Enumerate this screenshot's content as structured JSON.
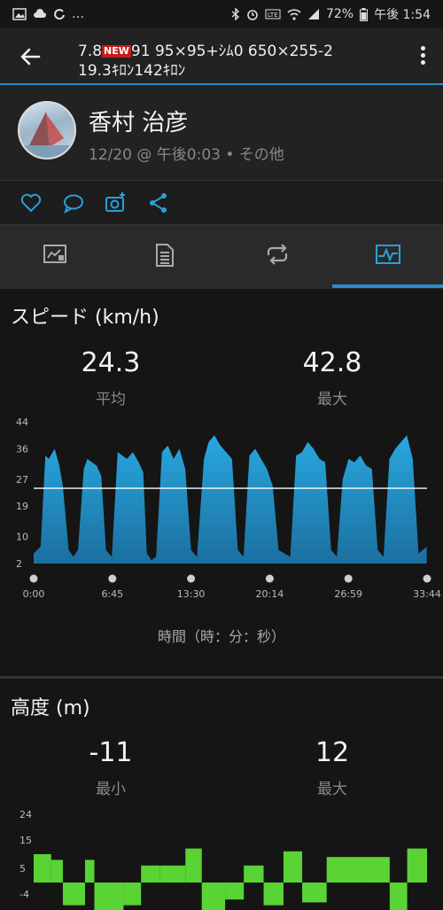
{
  "status_bar": {
    "left_icons": [
      "gallery-icon",
      "cloud-icon",
      "sync-icon",
      "more-icon"
    ],
    "right_icons": [
      "bluetooth-icon",
      "alarm-icon",
      "volte-icon",
      "wifi-icon",
      "signal-icon"
    ],
    "battery": "72%",
    "time": "午後 1:54"
  },
  "app_bar": {
    "title_part1": "7.8",
    "new_badge": "NEW",
    "title_part2": "91 95×95+ｼﾑ0 650×255-2",
    "title_line2": "19.3ｷﾛﾝ142ｷﾛﾝ"
  },
  "activity": {
    "user_name": "香村 治彦",
    "meta": "12/20 @ 午後0:03 • その他"
  },
  "tabs": [
    "summary-tab",
    "laps-tab",
    "splits-tab",
    "charts-tab"
  ],
  "colors": {
    "accent": "#2a8fc9",
    "speed": "#29a8e0",
    "elevation": "#5ad334"
  },
  "speed": {
    "title": "スピード (km/h)",
    "avg_value": "24.3",
    "avg_label": "平均",
    "max_value": "42.8",
    "max_label": "最大",
    "x_axis_title": "時間（時：分：秒）"
  },
  "elevation": {
    "title": "高度 (m)",
    "min_value": "-11",
    "min_label": "最小",
    "max_value": "12",
    "max_label": "最大"
  },
  "chart_data": [
    {
      "type": "area",
      "title": "スピード (km/h)",
      "xlabel": "時間（時：分：秒）",
      "ylabel": "",
      "x_ticks": [
        "0:00",
        "6:45",
        "13:30",
        "20:14",
        "26:59",
        "33:44"
      ],
      "y_ticks": [
        2,
        10,
        19,
        27,
        36,
        44
      ],
      "ylim": [
        2,
        44
      ],
      "xlim_minutes": [
        0,
        33.73
      ],
      "average_line": 24.3,
      "series": [
        {
          "x": [
            0.0,
            0.6,
            1.0,
            1.3,
            1.8,
            2.2,
            2.5,
            3.0,
            3.4,
            3.8,
            4.3,
            4.6,
            5.0,
            5.4,
            5.8,
            6.2,
            6.7,
            7.2,
            7.6,
            8.0,
            8.5,
            9.0,
            9.4,
            9.7,
            10.1,
            10.5,
            11.0,
            11.5,
            12.0,
            12.5,
            13.0,
            13.5,
            14.0,
            14.6,
            15.0,
            15.5,
            16.0,
            16.5,
            17.0,
            17.5,
            18.0,
            18.5,
            19.0,
            19.5,
            20.0,
            20.5,
            21.0,
            21.5,
            22.0,
            22.5,
            23.0,
            23.5,
            24.0,
            24.5,
            25.0,
            25.5,
            26.0,
            26.5,
            27.0,
            27.5,
            28.0,
            28.5,
            29.0,
            29.5,
            30.0,
            30.5,
            31.0,
            31.5,
            32.0,
            32.5,
            33.0,
            33.7
          ],
          "y": [
            5,
            7,
            34,
            33,
            36,
            31,
            25,
            6,
            4,
            6,
            30,
            33,
            32,
            31,
            28,
            6,
            4,
            35,
            34,
            33,
            35,
            32,
            29,
            5,
            3,
            4,
            35,
            37,
            33,
            36,
            30,
            6,
            4,
            33,
            38,
            40,
            37,
            35,
            33,
            6,
            4,
            34,
            36,
            33,
            30,
            25,
            6,
            5,
            4,
            34,
            35,
            38,
            36,
            33,
            32,
            6,
            4,
            27,
            33,
            32,
            34,
            31,
            30,
            6,
            4,
            33,
            36,
            38,
            40,
            33,
            5,
            7
          ]
        }
      ]
    },
    {
      "type": "area",
      "title": "高度 (m)",
      "xlabel": "",
      "ylabel": "",
      "y_ticks": [
        -4,
        5,
        15,
        24
      ],
      "ylim": [
        -11,
        24
      ],
      "x_minutes": [
        0,
        1.5,
        2.5,
        4.4,
        5.2,
        7.7,
        9.2,
        10.8,
        13.0,
        14.4,
        16.4,
        18.0,
        19.7,
        21.4,
        23.0,
        25.1,
        28.5,
        30.5,
        32.0,
        33.7
      ],
      "values": [
        10,
        8,
        -8,
        8,
        -10,
        -8,
        6,
        6,
        12,
        -11,
        -6,
        6,
        -8,
        11,
        -7,
        9,
        9,
        -10,
        12,
        12
      ]
    }
  ]
}
